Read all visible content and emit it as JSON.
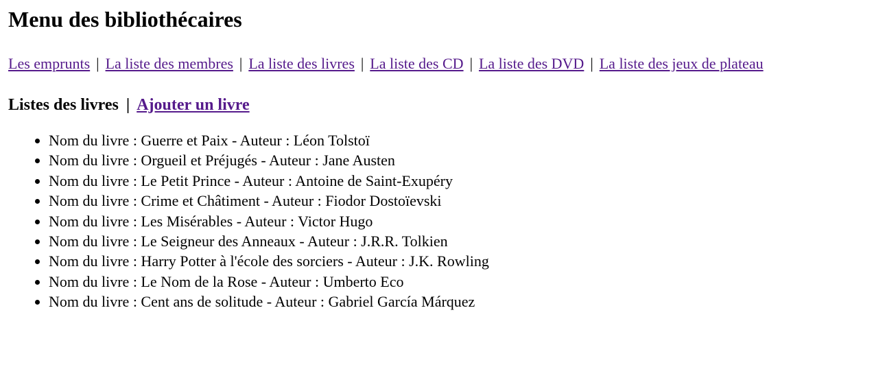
{
  "header": {
    "title": "Menu des bibliothécaires"
  },
  "nav": {
    "separator": "|",
    "links": [
      {
        "label": "Les emprunts"
      },
      {
        "label": "La liste des membres"
      },
      {
        "label": "La liste des livres"
      },
      {
        "label": "La liste des CD"
      },
      {
        "label": "La liste des DVD"
      },
      {
        "label": "La liste des jeux de plateau"
      }
    ]
  },
  "section": {
    "title": "Listes des livres",
    "separator": "|",
    "add_link": "Ajouter un livre"
  },
  "books": [
    "Nom du livre : Guerre et Paix - Auteur : Léon Tolstoï",
    "Nom du livre : Orgueil et Préjugés - Auteur : Jane Austen",
    "Nom du livre : Le Petit Prince - Auteur : Antoine de Saint-Exupéry",
    "Nom du livre : Crime et Châtiment - Auteur : Fiodor Dostoïevski",
    "Nom du livre : Les Misérables - Auteur : Victor Hugo",
    "Nom du livre : Le Seigneur des Anneaux - Auteur : J.R.R. Tolkien",
    "Nom du livre : Harry Potter à l'école des sorciers - Auteur : J.K. Rowling",
    "Nom du livre : Le Nom de la Rose - Auteur : Umberto Eco",
    "Nom du livre : Cent ans de solitude - Auteur : Gabriel García Márquez"
  ],
  "colors": {
    "link_visited": "#551a8b",
    "text": "#000000",
    "background": "#ffffff"
  }
}
